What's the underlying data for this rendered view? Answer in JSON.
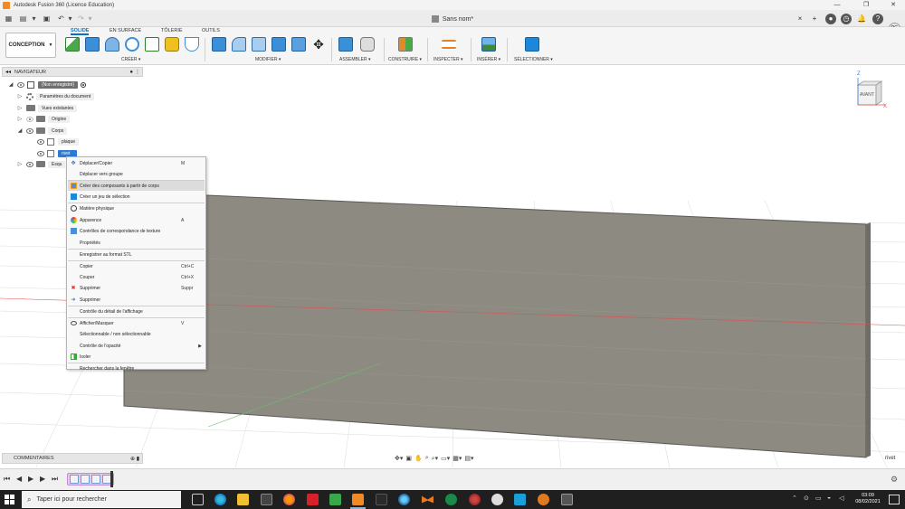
{
  "window": {
    "title": "Autodesk Fusion 360 (Licence Education)",
    "minimize": "—",
    "maximize": "❐",
    "close": "✕"
  },
  "document": {
    "tab_title": "Sans nom*",
    "tab_close": "×",
    "new_tab": "+",
    "user_initials": "PG"
  },
  "toolbar": {
    "workspace": "CONCEPTION",
    "tabs": [
      "SOLIDE",
      "EN SURFACE",
      "TÔLERIE",
      "OUTILS"
    ],
    "groups": [
      "CRÉER ▾",
      "MODIFIER ▾",
      "ASSEMBLER ▾",
      "CONSTRUIRE ▾",
      "INSPECTER ▾",
      "INSÉRER ▾",
      "SÉLECTIONNER ▾"
    ],
    "accent": "#0b6fc4"
  },
  "navigator": {
    "title": "NAVIGATEUR",
    "root_label": "(Non enregistré)",
    "items": [
      {
        "label": "Paramètres du document"
      },
      {
        "label": "Vues existantes"
      },
      {
        "label": "Origine"
      },
      {
        "label": "Corps"
      },
      {
        "label": "plaque"
      },
      {
        "label": "rivet"
      },
      {
        "label": "Esqu"
      }
    ]
  },
  "context_menu": {
    "items": [
      {
        "label": "Déplacer/Copier",
        "shortcut": "M",
        "icon": "move-icon"
      },
      {
        "label": "Déplacer vers groupe",
        "shortcut": "",
        "icon": "group-icon"
      },
      {
        "label": "Créer des composants à partir de corps",
        "shortcut": "",
        "icon": "components-icon"
      },
      {
        "label": "Créer un jeu de sélection",
        "shortcut": "",
        "icon": "selection-set-icon"
      },
      {
        "label": "Matière physique",
        "shortcut": "",
        "icon": "material-icon"
      },
      {
        "label": "Apparence",
        "shortcut": "A",
        "icon": "appearance-icon"
      },
      {
        "label": "Contrôles de correspondance de texture",
        "shortcut": "",
        "icon": "texture-icon"
      },
      {
        "label": "Propriétés",
        "shortcut": "",
        "icon": ""
      },
      {
        "label": "Enregistrer au format STL",
        "shortcut": "",
        "icon": ""
      },
      {
        "label": "Copier",
        "shortcut": "Ctrl+C",
        "icon": ""
      },
      {
        "label": "Couper",
        "shortcut": "Ctrl+X",
        "icon": ""
      },
      {
        "label": "Supprimer",
        "shortcut": "Suppr",
        "icon": "delete-icon"
      },
      {
        "label": "Supprimer",
        "shortcut": "",
        "icon": "remove-icon"
      },
      {
        "label": "Contrôle du détail de l'affichage",
        "shortcut": "",
        "icon": ""
      },
      {
        "label": "Afficher/Masquer",
        "shortcut": "V",
        "icon": "eye-icon"
      },
      {
        "label": "Sélectionnable / non sélectionnable",
        "shortcut": "",
        "icon": ""
      },
      {
        "label": "Contrôle de l'opacité",
        "shortcut": "▶",
        "icon": ""
      },
      {
        "label": "Isoler",
        "shortcut": "",
        "icon": "isolate-icon"
      },
      {
        "label": "Rechercher dans la fenêtre",
        "shortcut": "",
        "icon": ""
      }
    ]
  },
  "viewcube": {
    "face": "AVANT",
    "axis_z": "Z",
    "axis_x": "X"
  },
  "comments": {
    "title": "COMMENTAIRES"
  },
  "canvas": {
    "body_label": "rivet",
    "body_color": "#8d8a82"
  },
  "taskbar": {
    "search_placeholder": "Taper ici pour rechercher",
    "time": "03:09",
    "date": "08/02/2021"
  }
}
